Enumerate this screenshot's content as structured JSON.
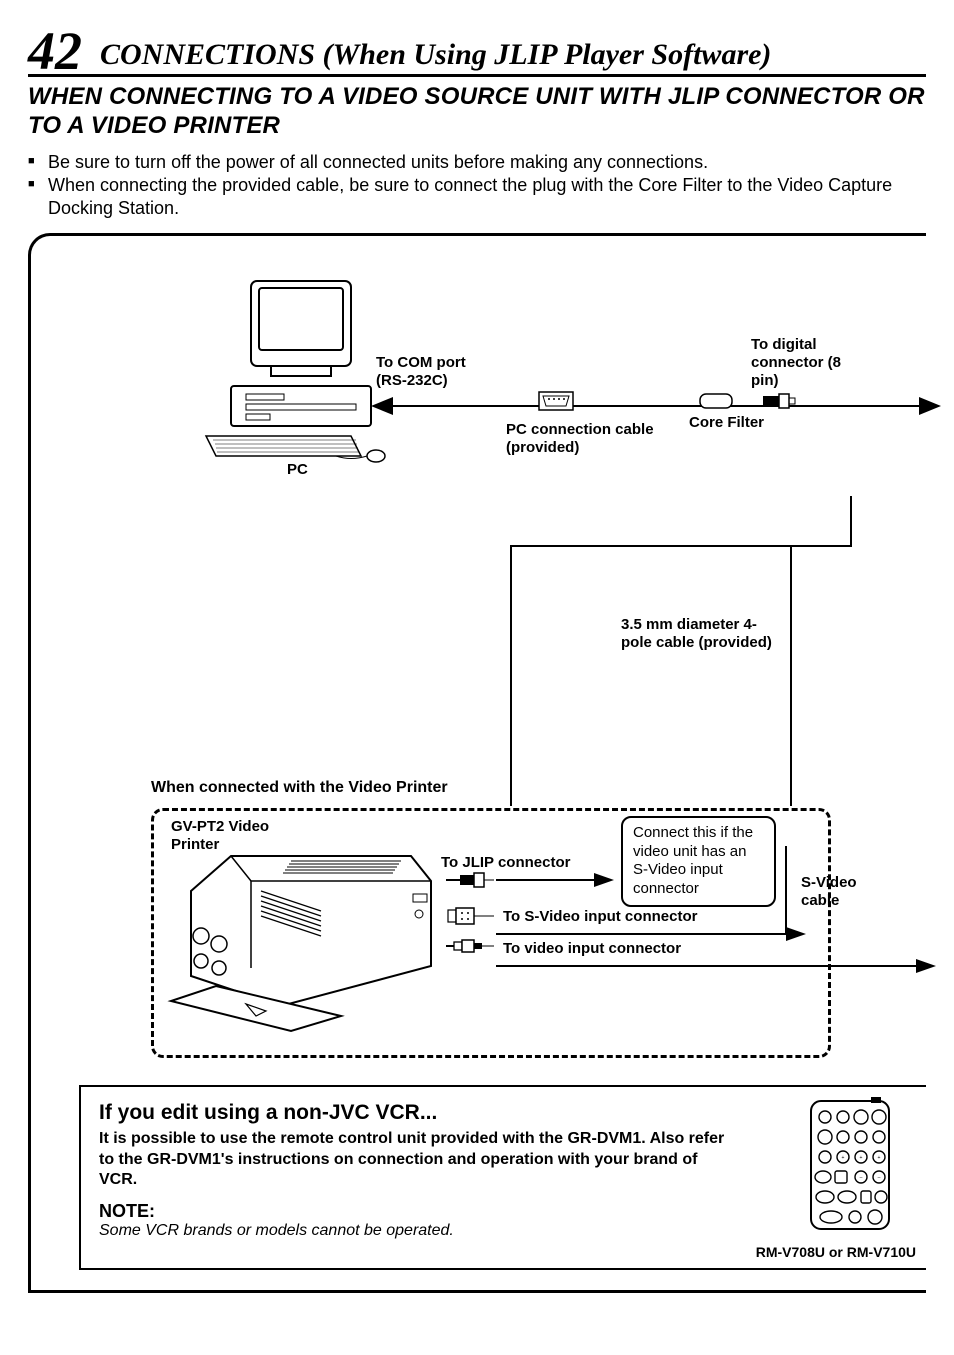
{
  "page_number": "42",
  "section_title": "CONNECTIONS (When Using JLIP Player Software)",
  "subheading": "WHEN CONNECTING TO A VIDEO SOURCE UNIT WITH JLIP CONNECTOR OR TO A VIDEO PRINTER",
  "bullets": [
    "Be sure to turn off the power of all connected units before making any connections.",
    "When connecting the provided cable, be sure to connect the plug with the Core Filter to the Video Capture Docking Station."
  ],
  "labels": {
    "to_com_port": "To COM port (RS-232C)",
    "pc": "PC",
    "pc_connection_cable": "PC connection cable (provided)",
    "core_filter": "Core Filter",
    "to_digital_connector": "To digital connector (8 pin)",
    "cable_35mm": "3.5 mm diameter 4-pole cable (provided)",
    "when_connected_printer": "When connected with the Video Printer",
    "gv_pt2": "GV-PT2 Video Printer",
    "to_jlip": "To JLIP connector",
    "to_svideo_input": "To S-Video input connector",
    "to_video_input": "To video input connector",
    "svideo_cable": "S-Video cable",
    "callout_svideo": "Connect this if the video unit has an S-Video input connector"
  },
  "note_box": {
    "title": "If you edit using a non-JVC VCR...",
    "body": "It is possible to use the remote control unit provided with  the GR-DVM1. Also refer to the GR-DVM1's instructions on connection and operation with your brand of VCR.",
    "note_label": "NOTE:",
    "note_text": "Some VCR brands or models cannot be operated.",
    "remote_caption": "RM-V708U or RM-V710U"
  }
}
